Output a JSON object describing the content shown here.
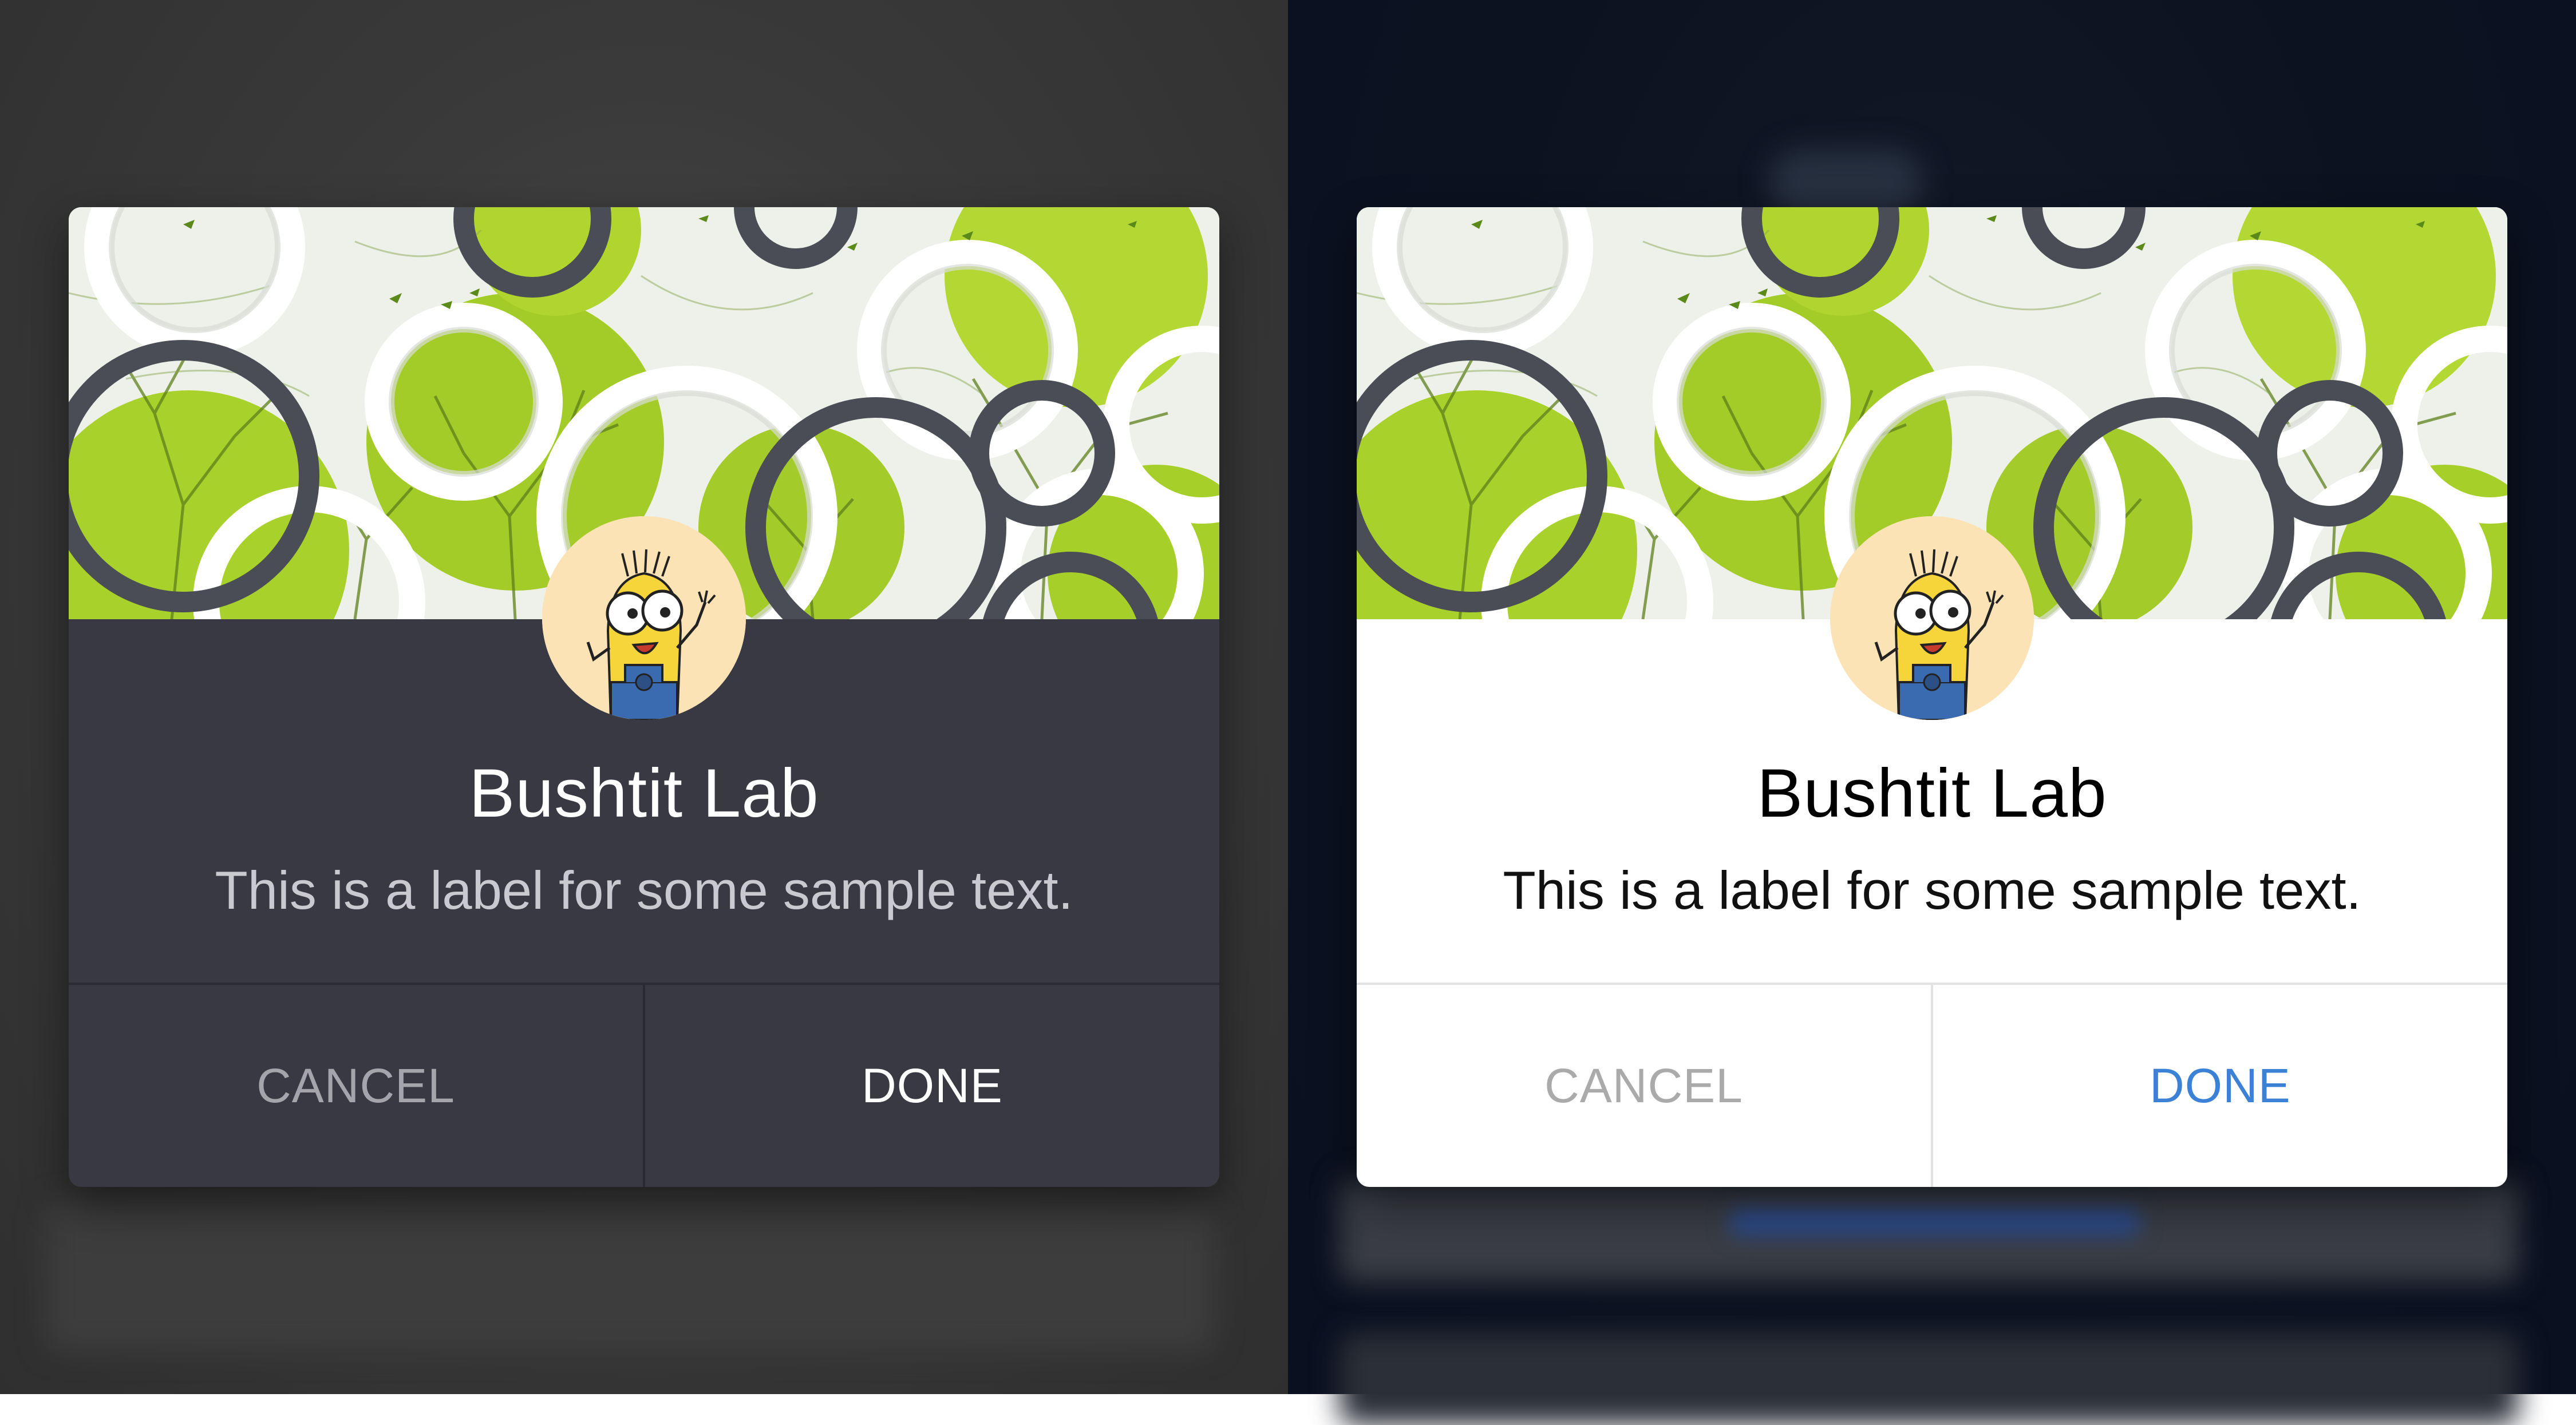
{
  "dialogs": {
    "dark": {
      "title": "Bushtit Lab",
      "subtitle": "This is a label for some sample text.",
      "cancel_label": "CANCEL",
      "done_label": "DONE"
    },
    "light": {
      "title": "Bushtit Lab",
      "subtitle": "This is a label for some sample text.",
      "cancel_label": "CANCEL",
      "done_label": "DONE"
    }
  },
  "colors": {
    "dark_dialog_bg": "#393944",
    "light_dialog_bg": "#ffffff",
    "done_light_accent": "#3b82d6",
    "cancel_gray": "#aaaaaa",
    "avatar_bg": "#fbe3b5",
    "banner_green": "#a8d02a"
  },
  "icons": {
    "banner": "rings-and-trees-banner",
    "avatar": "minion-avatar"
  }
}
